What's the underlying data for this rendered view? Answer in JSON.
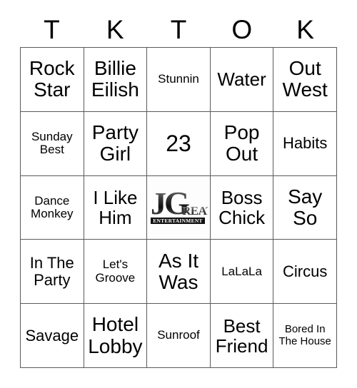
{
  "card": {
    "header_letters": [
      "T",
      "K",
      "T",
      "O",
      "K"
    ],
    "grid": [
      [
        "Rock Star",
        "Billie Eilish",
        "Stunnin",
        "Water",
        "Out West"
      ],
      [
        "Sunday Best",
        "Party Girl",
        "23",
        "Pop Out",
        "Habits"
      ],
      [
        "Dance Monkey",
        "I Like Him",
        "",
        "Boss Chick",
        "Say So"
      ],
      [
        "In The Party",
        "Let's Groove",
        "As It Was",
        "LaLaLa",
        "Circus"
      ],
      [
        "Savage",
        "Hotel Lobby",
        "Sunroof",
        "Best Friend",
        "Bored In The House"
      ]
    ],
    "free_space_logo": {
      "primary_text": "JG",
      "secondary_text": "REAT",
      "tagline": "ENTERTAINMENT"
    },
    "colors": {
      "border": "#5a5a5a",
      "text": "#000000",
      "background": "#ffffff"
    }
  }
}
